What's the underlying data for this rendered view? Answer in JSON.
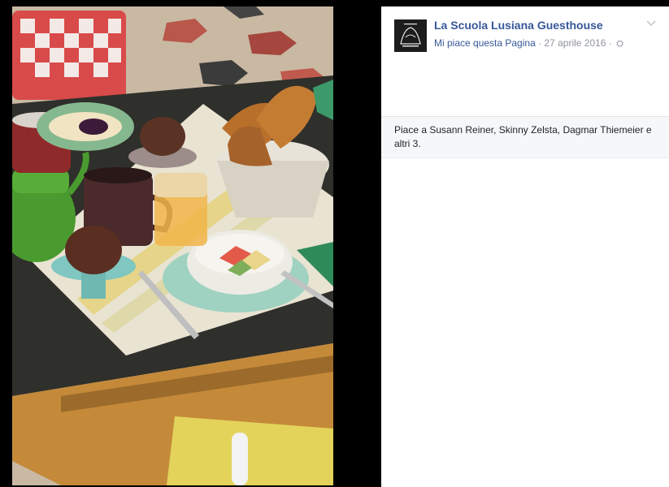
{
  "post": {
    "page_name": "La Scuola Lusiana Guesthouse",
    "like_page": "Mi piace questa Pagina",
    "separator": " · ",
    "date": "27 aprile 2016",
    "audience_icon": "globe-icon"
  },
  "likes": {
    "text": "Piace a Susann Reiner, Skinny Zelsta, Dagmar Thiemeier e altri 3."
  },
  "photo": {
    "alt": "breakfast table with croissants, muffins, tea and fruit"
  },
  "colors": {
    "link": "#365899",
    "meta": "#90949c",
    "background": "#000000"
  }
}
